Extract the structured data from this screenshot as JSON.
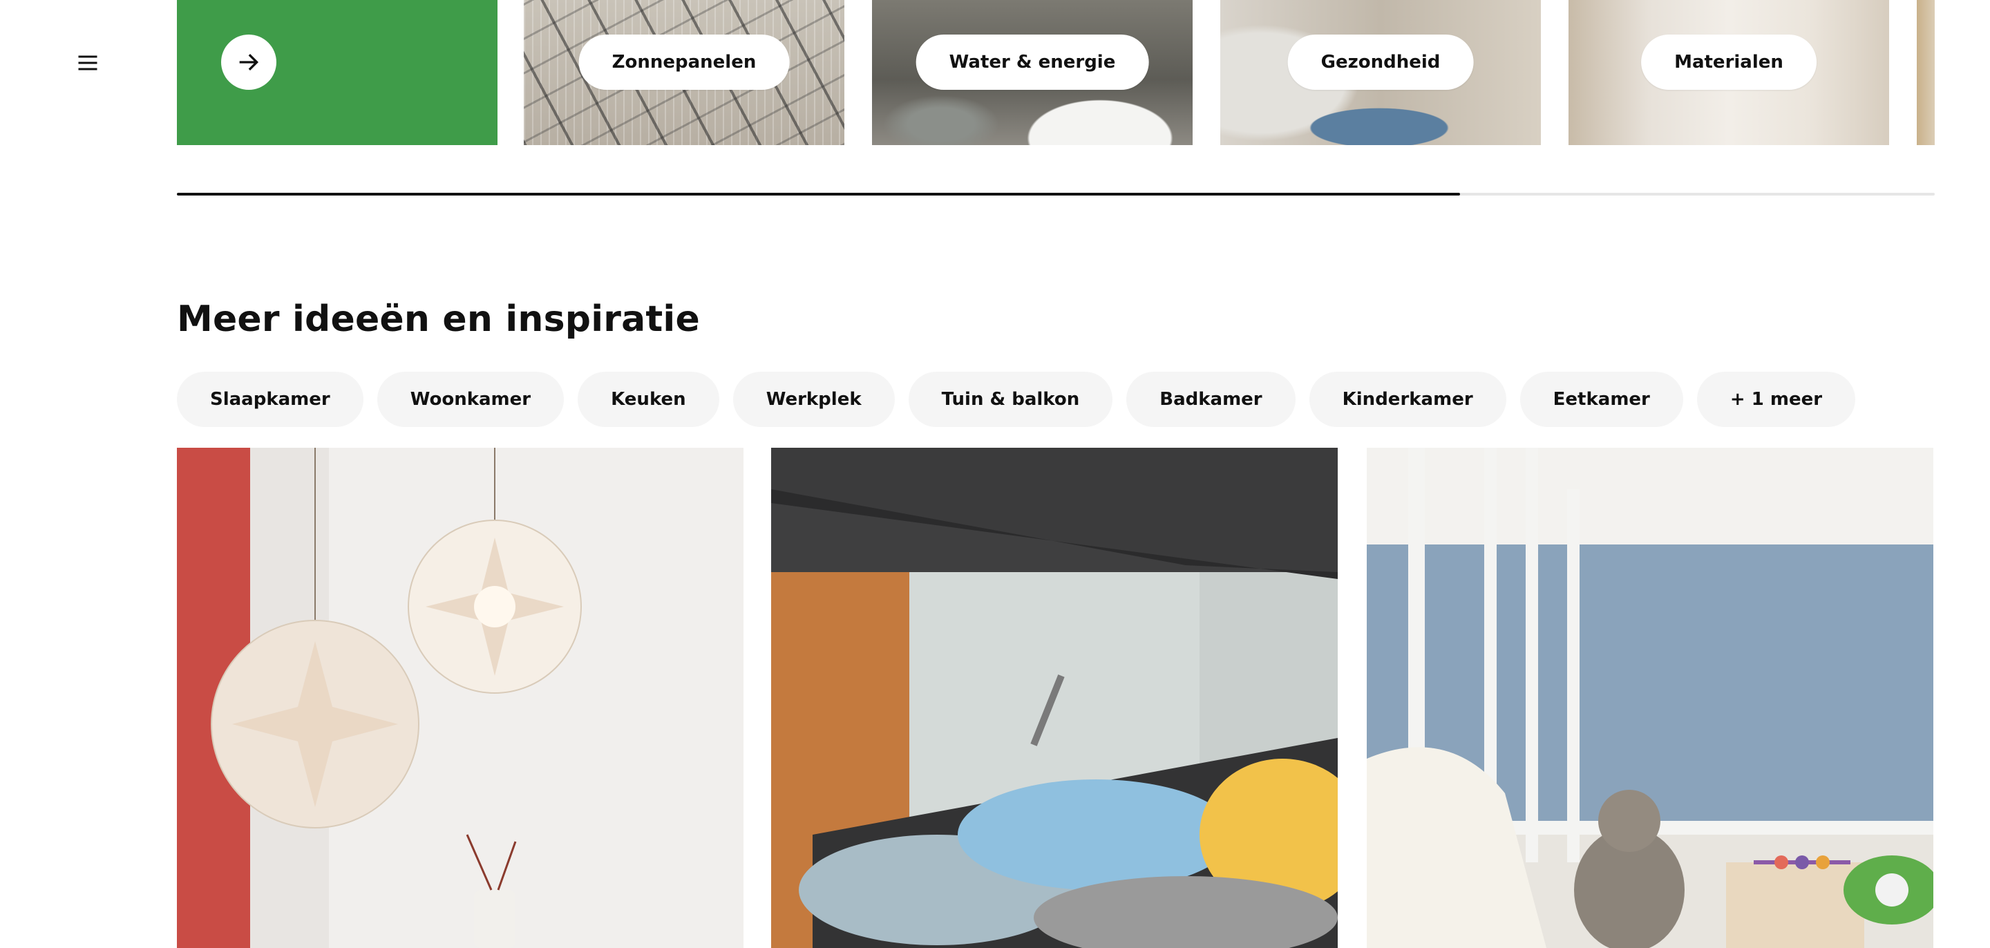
{
  "carousel": {
    "tiles": [
      {
        "label": "Zonnepanelen"
      },
      {
        "label": "Water & energie"
      },
      {
        "label": "Gezondheid"
      },
      {
        "label": "Materialen"
      }
    ],
    "scroll_progress_percent": 73
  },
  "section": {
    "title": "Meer ideeën en inspiratie",
    "chips": [
      "Slaapkamer",
      "Woonkamer",
      "Keuken",
      "Werkplek",
      "Tuin & balkon",
      "Badkamer",
      "Kinderkamer",
      "Eetkamer",
      "+ 1 meer"
    ]
  },
  "colors": {
    "accent_green": "#3f9c49",
    "chip_background": "#f5f5f5",
    "text": "#111111"
  },
  "icons": {
    "menu": "hamburger-menu-icon",
    "carousel_arrow": "arrow-right-icon"
  }
}
